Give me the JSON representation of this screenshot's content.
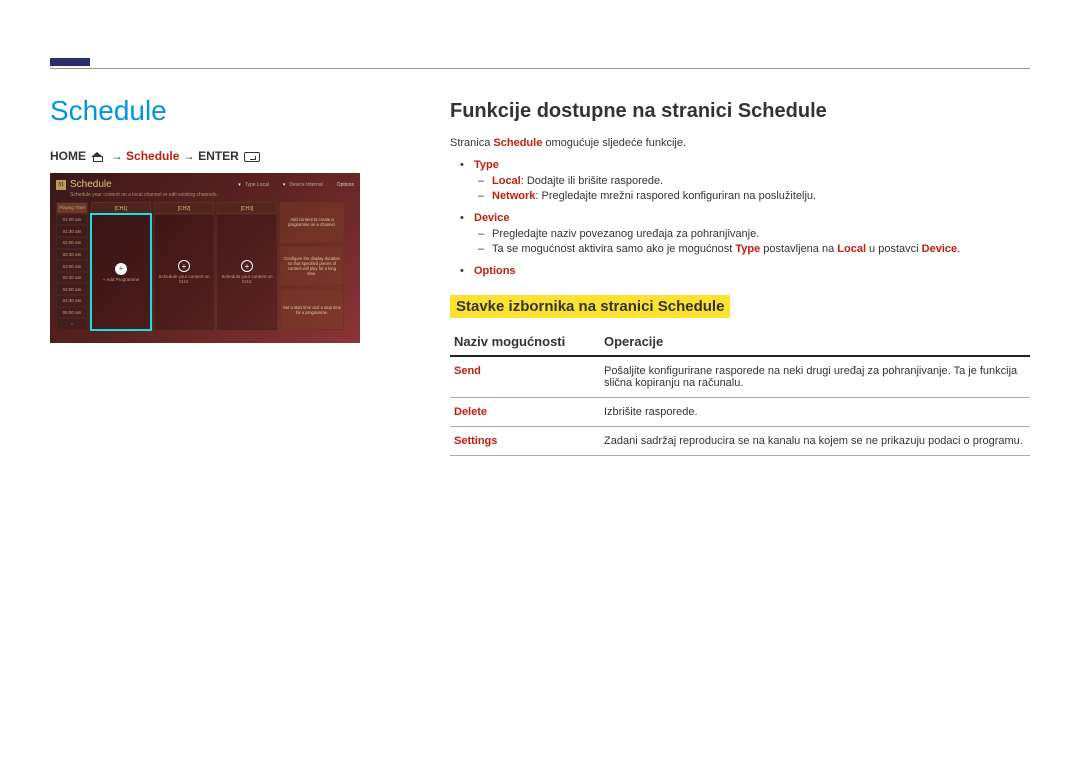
{
  "left": {
    "title": "Schedule",
    "breadcrumb": {
      "home": "HOME",
      "arrow1": "→",
      "schedule": "Schedule",
      "arrow2": "→",
      "enter": "ENTER"
    }
  },
  "shot": {
    "cal_num": "31",
    "title": "Schedule",
    "type_lbl": "Type Local",
    "device_lbl": "Device Internal",
    "options": "Options",
    "subtitle": "Schedule your content on a local channel or edit existing channels.",
    "playing_time": "Playing Time",
    "times": [
      "01:00 am",
      "01:30 am",
      "02:00 am",
      "02:30 am",
      "03:00 am",
      "03:30 am",
      "04:00 am",
      "04:30 am",
      "05:00 am"
    ],
    "ch1": "[CH1]",
    "ch2": "[CH2]",
    "ch3": "[CH3]",
    "add_prog": "+ Add Programme",
    "sched_ch2": "Schedule your content on CH2.",
    "sched_ch3": "Schedule your content on CH3.",
    "card1": "Add content to create a programme on a channel.",
    "card2": "Configure the display duration so that specified pieces of content will play for a long time.",
    "card3": "Set a start time and a stop time for a programme."
  },
  "right": {
    "h2": "Funkcije dostupne na stranici Schedule",
    "intro_pre": "Stranica ",
    "intro_bold": "Schedule",
    "intro_post": " omogućuje sljedeće funkcije.",
    "bullets": {
      "type": "Type",
      "type_local_b": "Local",
      "type_local_t": ": Dodajte ili brišite rasporede.",
      "type_net_b": "Network",
      "type_net_t": ": Pregledajte mrežni raspored konfiguriran na poslužitelju.",
      "device": "Device",
      "device_line": "Pregledajte naziv povezanog uređaja za pohranjivanje.",
      "device_note_pre": "Ta se mogućnost aktivira samo ako je mogućnost ",
      "device_note_type": "Type",
      "device_note_mid": " postavljena na ",
      "device_note_local": "Local",
      "device_note_mid2": " u postavci ",
      "device_note_dev": "Device",
      "device_note_end": ".",
      "options": "Options"
    },
    "sub_h3": "Stavke izbornika na stranici Schedule",
    "table": {
      "col1": "Naziv mogućnosti",
      "col2": "Operacije",
      "rows": [
        {
          "name": "Send",
          "desc": "Pošaljite konfigurirane rasporede na neki drugi uređaj za pohranjivanje. Ta je funkcija slična kopiranju na računalu."
        },
        {
          "name": "Delete",
          "desc": "Izbrišite rasporede."
        },
        {
          "name": "Settings",
          "desc": "Zadani sadržaj reproducira se na kanalu na kojem se ne prikazuju podaci o programu."
        }
      ]
    }
  }
}
